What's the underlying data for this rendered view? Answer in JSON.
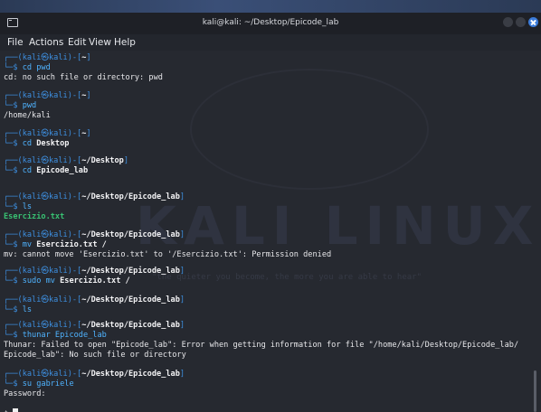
{
  "window": {
    "title": "kali@kali: ~/Desktop/Epicode_lab",
    "accent_close": "#3b7bd9"
  },
  "menu": {
    "file": "File",
    "actions": "Actions",
    "edit": "Edit",
    "view": "View",
    "help": "Help"
  },
  "prompt": {
    "corner_top": "┌──(",
    "corner_bottom": "└─",
    "user_host": "kali㉿kali",
    "sep": ")-[",
    "close": "]",
    "dollar": "$"
  },
  "blocks": [
    {
      "path": "~",
      "cmd": "cd pwd",
      "output": [
        "cd: no such file or directory: pwd"
      ]
    },
    {
      "path": "~",
      "cmd": "pwd",
      "output": [
        "/home/kali"
      ]
    },
    {
      "path": "~",
      "cmd_pre": "cd ",
      "cmd_bold": "Desktop",
      "output": []
    },
    {
      "path": "~/Desktop",
      "cmd_pre": "cd ",
      "cmd_bold": "Epicode_lab",
      "output": []
    },
    {
      "path": "~/Desktop/Epicode_lab",
      "cmd": "ls",
      "output_green": "Esercizio.txt"
    },
    {
      "path": "~/Desktop/Epicode_lab",
      "cmd_pre": "mv ",
      "cmd_bold": "Esercizio.txt /",
      "output": [
        "mv: cannot move 'Esercizio.txt' to '/Esercizio.txt': Permission denied"
      ]
    },
    {
      "path": "~/Desktop/Epicode_lab",
      "cmd_pre": "sudo mv ",
      "cmd_bold": "Esercizio.txt /",
      "output": []
    },
    {
      "path": "~/Desktop/Epicode_lab",
      "cmd": "ls",
      "output": []
    },
    {
      "path": "~/Desktop/Epicode_lab",
      "cmd": "thunar Epicode_lab",
      "output": [
        "Thunar: Failed to open \"Epicode_lab\": Error when getting information for file \"/home/kali/Desktop/Epicode_lab/",
        "Epicode_lab\": No such file or directory"
      ]
    },
    {
      "path": "~/Desktop/Epicode_lab",
      "cmd": "su gabriele",
      "output": [
        "Password:"
      ]
    }
  ],
  "last_prompt": "$",
  "wallpaper": {
    "logo_text": "KALI LINUX",
    "tagline": "\"the quieter you become, the more you are able to hear\""
  }
}
